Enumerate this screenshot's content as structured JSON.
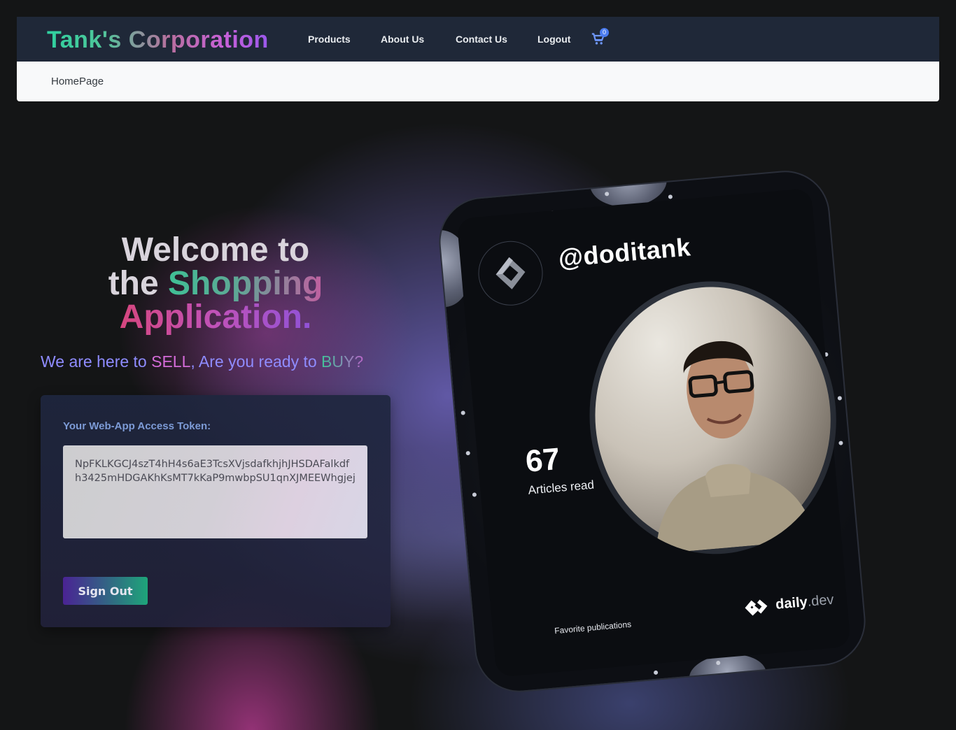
{
  "brand": "Tank's Corporation",
  "nav": {
    "items": [
      {
        "label": "Products"
      },
      {
        "label": "About Us"
      },
      {
        "label": "Contact Us"
      },
      {
        "label": "Logout"
      }
    ],
    "cart_count": "0"
  },
  "breadcrumb": "HomePage",
  "hero": {
    "line1": "Welcome to",
    "line2_plain": "the ",
    "line2_accent": "Shopping",
    "line3": "Application."
  },
  "tagline": {
    "part1": "We are here to ",
    "sell": "SELL",
    "part2": ", Are you ready to ",
    "buy": "BUY?"
  },
  "token": {
    "label": "Your Web-App Access Token:",
    "value": "NpFKLKGCJ4szT4hH4s6aE3TcsXVjsdafkhjhJHSDAFalkdfh3425mHDGAKhKsMT7kKaP9mwbpSU1qnXJMEEWhgjej"
  },
  "signout_label": "Sign Out",
  "devcard": {
    "handle": "@doditank",
    "articles_count": "67",
    "articles_label": "Articles read",
    "favorite_label": "Favorite publications",
    "brand_main": "daily",
    "brand_suffix": ".dev"
  },
  "colors": {
    "topbar": "#1f2838",
    "accent_green": "#2fd1a0",
    "accent_purple": "#9a58ec",
    "accent_pink": "#d6467e"
  }
}
